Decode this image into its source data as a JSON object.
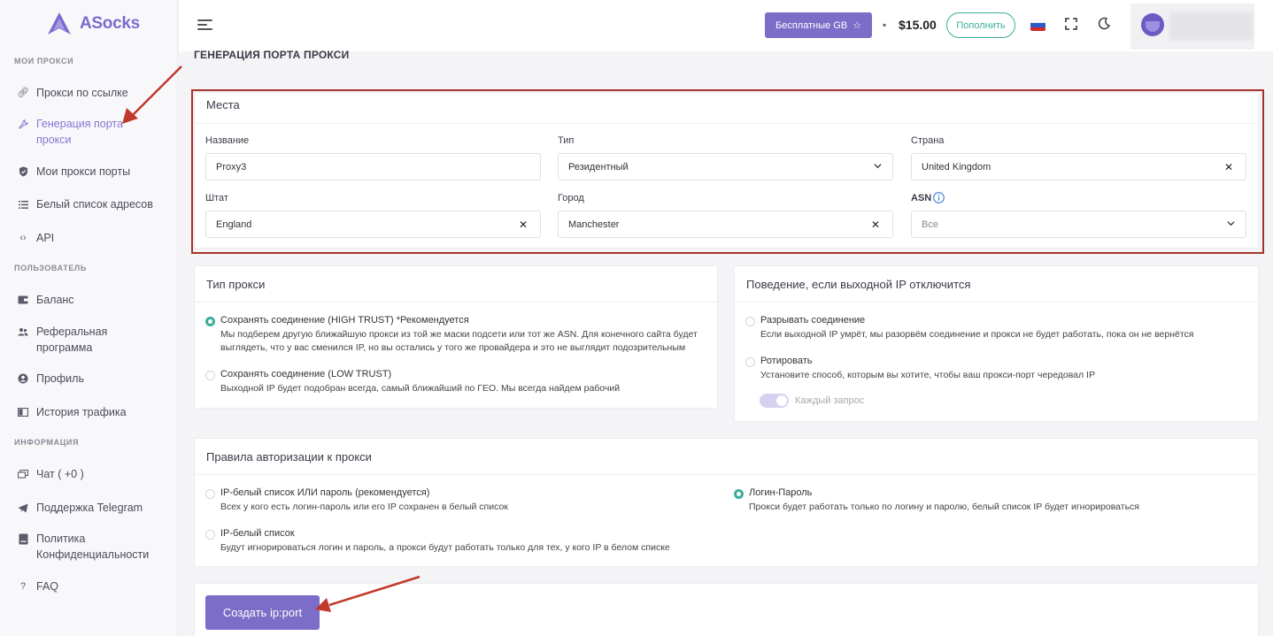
{
  "app": {
    "logo_text": "ASocks"
  },
  "sidebar": {
    "sections": {
      "my_proxies": "Мои прокси",
      "user": "Пользователь",
      "info": "Информация"
    },
    "items": [
      {
        "label": "Прокси по ссылке",
        "icon": "link-icon"
      },
      {
        "label": "Генерация порта прокси",
        "icon": "wrench-icon",
        "active": true
      },
      {
        "label": "Мои прокси порты",
        "icon": "shield-icon"
      },
      {
        "label": "Белый список адресов",
        "icon": "list-icon"
      },
      {
        "label": "API",
        "icon": "code-icon"
      },
      {
        "label": "Баланс",
        "icon": "wallet-icon"
      },
      {
        "label": "Реферальная программа",
        "icon": "users-icon"
      },
      {
        "label": "Профиль",
        "icon": "profile-icon"
      },
      {
        "label": "История трафика",
        "icon": "history-icon"
      },
      {
        "label": "Чат ( +0 )",
        "icon": "chat-icon"
      },
      {
        "label": "Поддержка Telegram",
        "icon": "telegram-icon"
      },
      {
        "label": "Политика Конфиденциальности",
        "icon": "document-icon"
      },
      {
        "label": "FAQ",
        "icon": "question-icon"
      }
    ]
  },
  "header": {
    "free_gb_button": "Бесплатные GB",
    "balance": "$15.00",
    "topup_button": "Пополнить",
    "language": "ru"
  },
  "page": {
    "title": "ГЕНЕРАЦИЯ ПОРТА ПРОКСИ"
  },
  "places": {
    "title": "Места",
    "name_label": "Название",
    "name_value": "Proxy3",
    "type_label": "Тип",
    "type_value": "Резидентный",
    "country_label": "Страна",
    "country_value": "United Kingdom",
    "state_label": "Штат",
    "state_value": "England",
    "city_label": "Город",
    "city_value": "Manchester",
    "asn_label": "ASN",
    "asn_value": "Все"
  },
  "proxy_type": {
    "title": "Тип прокси",
    "options": [
      {
        "title": "Сохранять соединение (HIGH TRUST) *Рекомендуется",
        "desc1": "Мы подберем другую ближайшую прокси из той же маски подсети или тот же ASN. Для конечного сайта будет",
        "desc2": "выглядеть, что у вас сменился IP, но вы остались у того же провайдера и это не выглядит подозрительным",
        "selected": true
      },
      {
        "title": "Сохранять соединение (LOW TRUST)",
        "desc1": "Выходной IP будет подобран всегда, самый ближайший по ГЕО. Мы всегда найдем рабочий",
        "selected": false
      }
    ]
  },
  "behavior": {
    "title": "Поведение, если выходной IP отключится",
    "options": [
      {
        "title": "Разрывать соединение",
        "desc1": "Если выходной IP умрёт, мы разорвём соединение и прокси не будет работать, пока он не вернётся",
        "selected": false
      },
      {
        "title": "Ротировать",
        "desc1": "Установите способ, которым вы хотите, чтобы ваш прокси-порт чередовал IP",
        "selected": false
      }
    ],
    "toggle_label": "Каждый запрос"
  },
  "auth": {
    "title": "Правила авторизации к прокси",
    "options": [
      {
        "title": "IP-белый список ИЛИ пароль (рекомендуется)",
        "desc1": "Всех у кого есть логин-пароль или его IP сохранен в белый список",
        "selected": false
      },
      {
        "title": "IP-белый список",
        "desc1": "Будут игнорироваться логин и пароль, а прокси будут работать только для тех, у кого IP в белом списке",
        "selected": false
      },
      {
        "title": "Логин-Пароль",
        "desc1": "Прокси будет работать только по логину и паролю, белый список IP будет игнорироваться",
        "selected": true
      }
    ]
  },
  "create_button": "Создать ip:port",
  "colors": {
    "accent": "#7c6dc8",
    "success": "#3cae9a",
    "annotation": "#c0392b"
  }
}
